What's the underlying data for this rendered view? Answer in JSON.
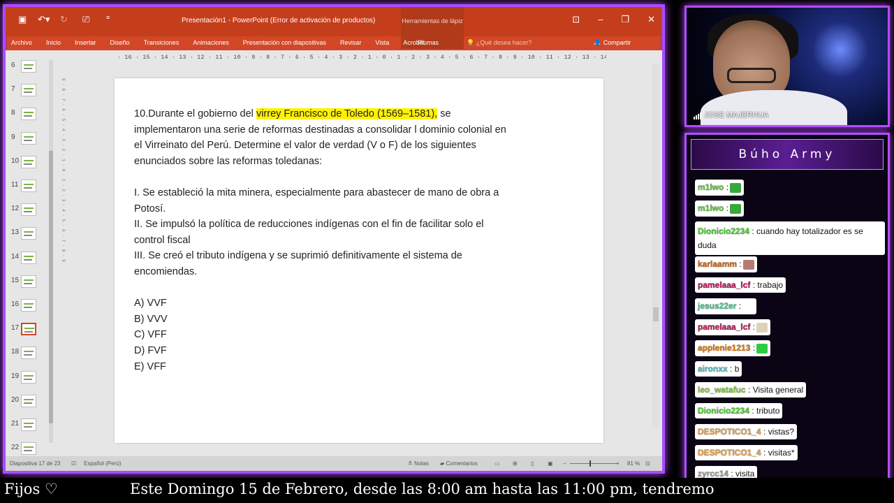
{
  "ppt": {
    "doc_title": "Presentación1 - PowerPoint (Error de activación de productos)",
    "context_group": "Herramientas de lápiz",
    "menu": [
      "Archivo",
      "Inicio",
      "Insertar",
      "Diseño",
      "Transiciones",
      "Animaciones",
      "Presentación con diapositivas",
      "Revisar",
      "Vista",
      "Acrobat"
    ],
    "plumas": "Plumas",
    "tell_me": "¿Qué desea hacer?",
    "share": "Compartir",
    "ruler": "· 16 · 15 · 14 · 13 · 12 · 11 · 10 · 9 · 8 · 7 · 6 · 5 · 4 · 3 · 2 · 1 · 0 · 1 · 2 · 3 · 4 · 5 · 6 · 7 · 8 · 9 · 10 · 11 · 12 · 13 · 14 · 15 · 16 ·",
    "vruler": "9 · 8 · 7 · 6 · 5 · 4 · 3 · 2 · 1 · 0 · 1 · 2 · 3 · 4 · 5 · 6 · 7 · 8 · 9",
    "thumbnails": [
      "6",
      "7",
      "8",
      "9",
      "10",
      "11",
      "12",
      "13",
      "14",
      "15",
      "16",
      "17",
      "18",
      "19",
      "20",
      "21",
      "22"
    ],
    "slide": {
      "q_prefix": "10.Durante el gobierno del ",
      "q_highlight": "virrey Francisco de Toledo (1569–1581),",
      "q_rest": " se implementaron una serie de reformas destinadas a consolidar  l dominio colonial en el Virreinato del Perú. Determine el valor de verdad (V o F) de los siguientes enunciados sobre las reformas toledanas:",
      "s1": "I. Se estableció la mita minera, especialmente para abastecer de mano de obra a Potosí.",
      "s2": "II. Se impulsó la política de reducciones indígenas con el fin de facilitar solo el control fiscal",
      "s3": "III. Se creó el tributo indígena y se suprimió definitivamente el sistema de encomiendas.",
      "options": [
        "A) VVF",
        "B) VVV",
        "C) VFF",
        "D) FVF",
        "E) VFF"
      ]
    },
    "status": {
      "slide_info": "Diapositiva 17 de 23",
      "language": "Español (Perú)",
      "notes": "Notas",
      "comments": "Comentarios",
      "zoom": "81 %"
    }
  },
  "webcam": {
    "name": "JOSE MAJERHUA"
  },
  "chat": {
    "title": "Búho Army",
    "messages": [
      {
        "user": "m1lwo",
        "text": ":",
        "color": "#5cc93f",
        "emote": "#37a83a"
      },
      {
        "user": "m1lwo",
        "text": ":",
        "color": "#5cc93f",
        "emote": "#37a83a"
      },
      {
        "user": "Dionicio2234",
        "text": ": cuando hay totalizador es se",
        "text2": "duda",
        "color": "#4ccf30"
      },
      {
        "user": "karlaamm",
        "text": ":",
        "color": "#d2691e",
        "emote": "#b97a74"
      },
      {
        "user": "pamelaaa_lcf",
        "text": ": trabajo",
        "color": "#c2185b"
      },
      {
        "user": "jesus22er",
        "text": ":",
        "color": "#52c39a",
        "emote": "#ffffff"
      },
      {
        "user": "pamelaaa_lcf",
        "text": ":",
        "color": "#c2185b",
        "emote": "#ddd2b8"
      },
      {
        "user": "applenie1213",
        "text": ":",
        "color": "#e07a10",
        "emote": "#2ecc40"
      },
      {
        "user": "aironxx",
        "text": ": b",
        "color": "#4fc3c8"
      },
      {
        "user": "leo_watafuc",
        "text": ": Visita general",
        "color": "#8bc34a"
      },
      {
        "user": "Dionicio2234",
        "text": ": tributo",
        "color": "#4ccf30"
      },
      {
        "user": "DESPOTICO1_4",
        "text": ": vistas?",
        "color": "#e6a44c"
      },
      {
        "user": "DESPOTICO1_4",
        "text": ": visitas*",
        "color": "#e6a44c"
      },
      {
        "user": "zyrcc14",
        "text": ": visita",
        "color": "#9e9e9e"
      }
    ]
  },
  "ticker": {
    "fijos": "Fijos ♡",
    "text": "Este Domingo 15 de Febrero, desde las 8:00 am hasta las 11:00 pm, tendremo"
  }
}
